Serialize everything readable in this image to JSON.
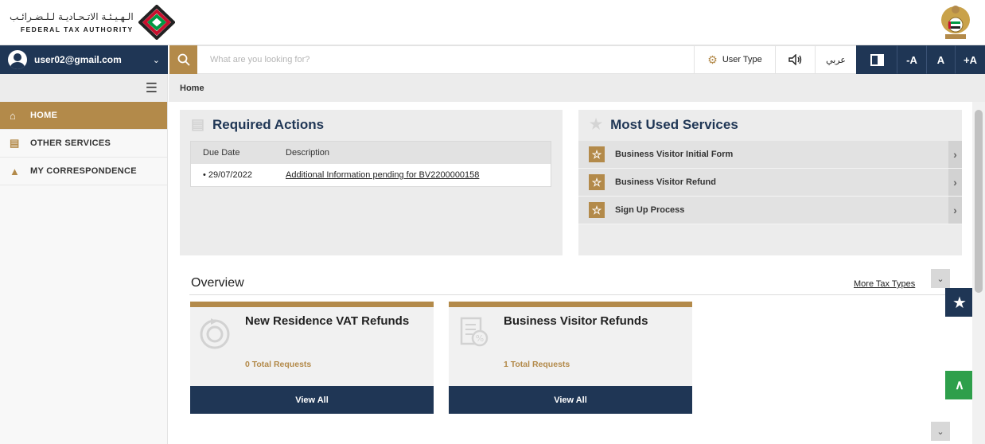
{
  "header": {
    "logo_ar": "الـهـيـئـة الاتـحـاديـة لـلـضـرائـب",
    "logo_en": "FEDERAL TAX AUTHORITY"
  },
  "topbar": {
    "user_email": "user02@gmail.com",
    "search_placeholder": "What are you looking for?",
    "user_type_label": "User Type",
    "language_label": "عربي",
    "font_decrease": "-A",
    "font_normal": "A",
    "font_increase": "+A"
  },
  "sidebar": {
    "items": [
      {
        "label": "HOME",
        "icon": "home-icon",
        "active": true
      },
      {
        "label": "OTHER SERVICES",
        "icon": "clipboard-icon",
        "active": false
      },
      {
        "label": "MY CORRESPONDENCE",
        "icon": "bank-icon",
        "active": false
      }
    ]
  },
  "breadcrumb": "Home",
  "required_actions": {
    "title": "Required Actions",
    "columns": [
      "Due Date",
      "Description"
    ],
    "rows": [
      {
        "date": "• 29/07/2022",
        "description": "Additional Information pending for BV2200000158"
      }
    ]
  },
  "most_used": {
    "title": "Most Used Services",
    "items": [
      "Business Visitor Initial Form",
      "Business Visitor Refund",
      "Sign Up Process"
    ]
  },
  "overview": {
    "title": "Overview",
    "more_link": "More Tax Types",
    "cards": [
      {
        "title": "New Residence VAT Refunds",
        "count": "0 Total Requests",
        "button": "View All"
      },
      {
        "title": "Business Visitor Refunds",
        "count": "1 Total Requests",
        "button": "View All"
      }
    ]
  },
  "colors": {
    "navy": "#1f3655",
    "gold": "#b38a4a",
    "green": "#2e9f4b"
  }
}
